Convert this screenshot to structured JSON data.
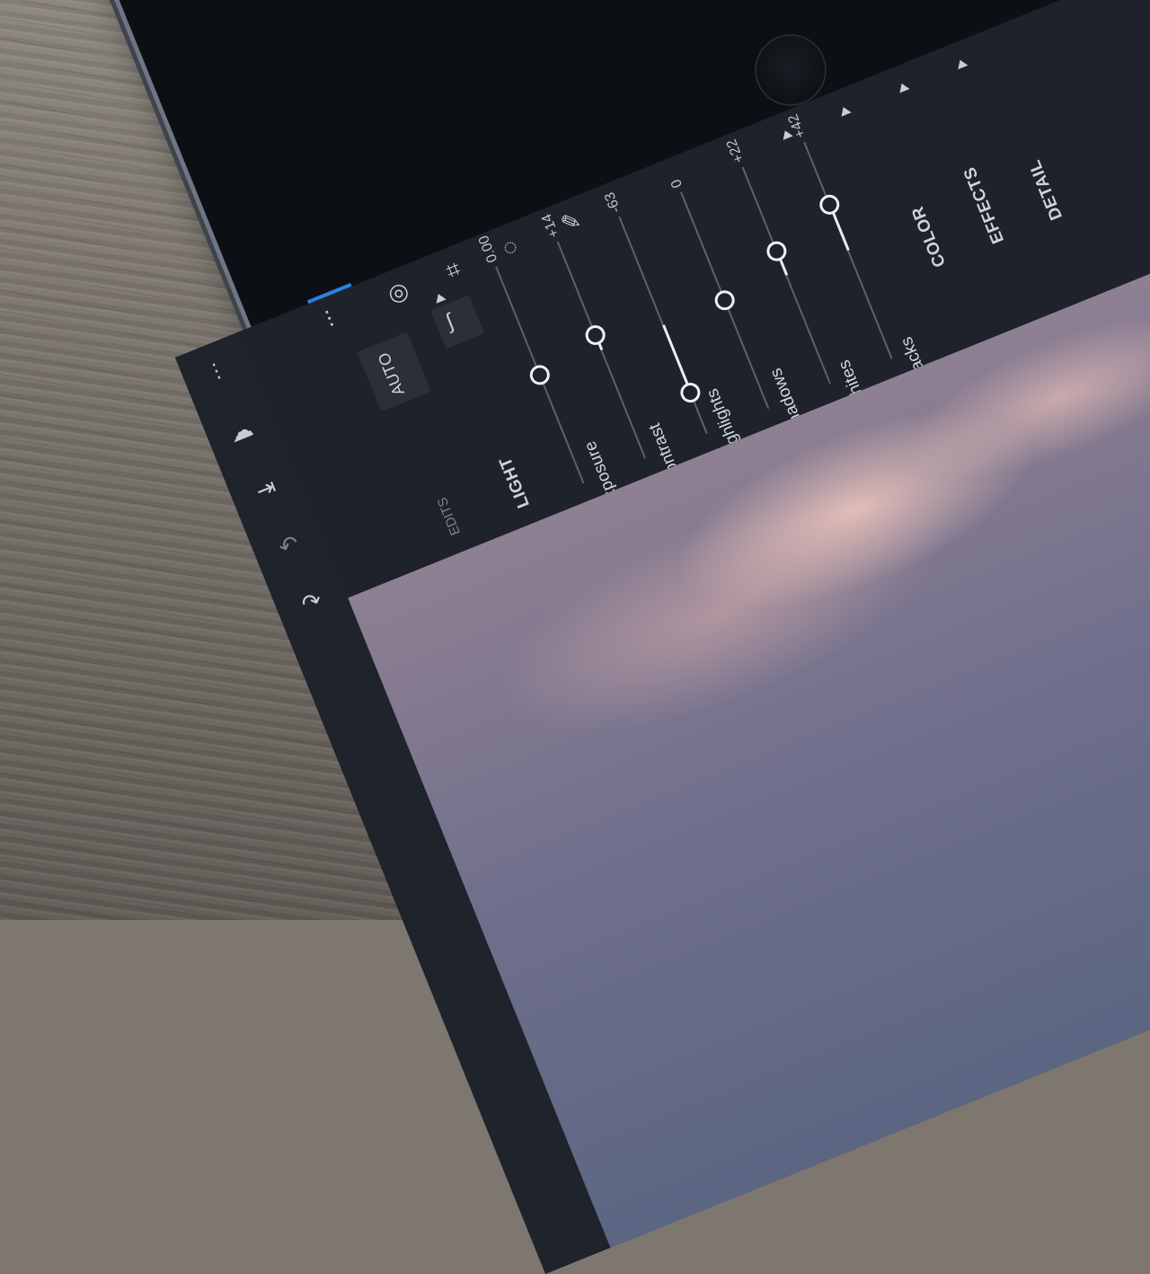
{
  "panel": {
    "auto_label": "AUTO",
    "edits_label": "EDITS",
    "section_light": "LIGHT",
    "sections": [
      "COLOR",
      "EFFECTS",
      "DETAIL"
    ],
    "sliders": [
      {
        "label": "Exposure",
        "value": "0.00",
        "level": 0.5
      },
      {
        "label": "Contrast",
        "value": "+14",
        "level": 0.57
      },
      {
        "label": "Highlights",
        "value": "-63",
        "level": 0.19
      },
      {
        "label": "Shadows",
        "value": "0",
        "level": 0.5
      },
      {
        "label": "Whites",
        "value": "+22",
        "level": 0.61
      },
      {
        "label": "Blacks",
        "value": "+42",
        "level": 0.71
      }
    ]
  },
  "icons": [
    "more-icon",
    "cloud-icon",
    "export-icon",
    "undo-icon",
    "redo-icon",
    "sliders-icon",
    "color-mix-icon",
    "crop-icon",
    "selective-icon",
    "heal-icon",
    "curve-icon"
  ],
  "colors": {
    "accent": "#2f7fe0",
    "panel": "#1d222b"
  }
}
